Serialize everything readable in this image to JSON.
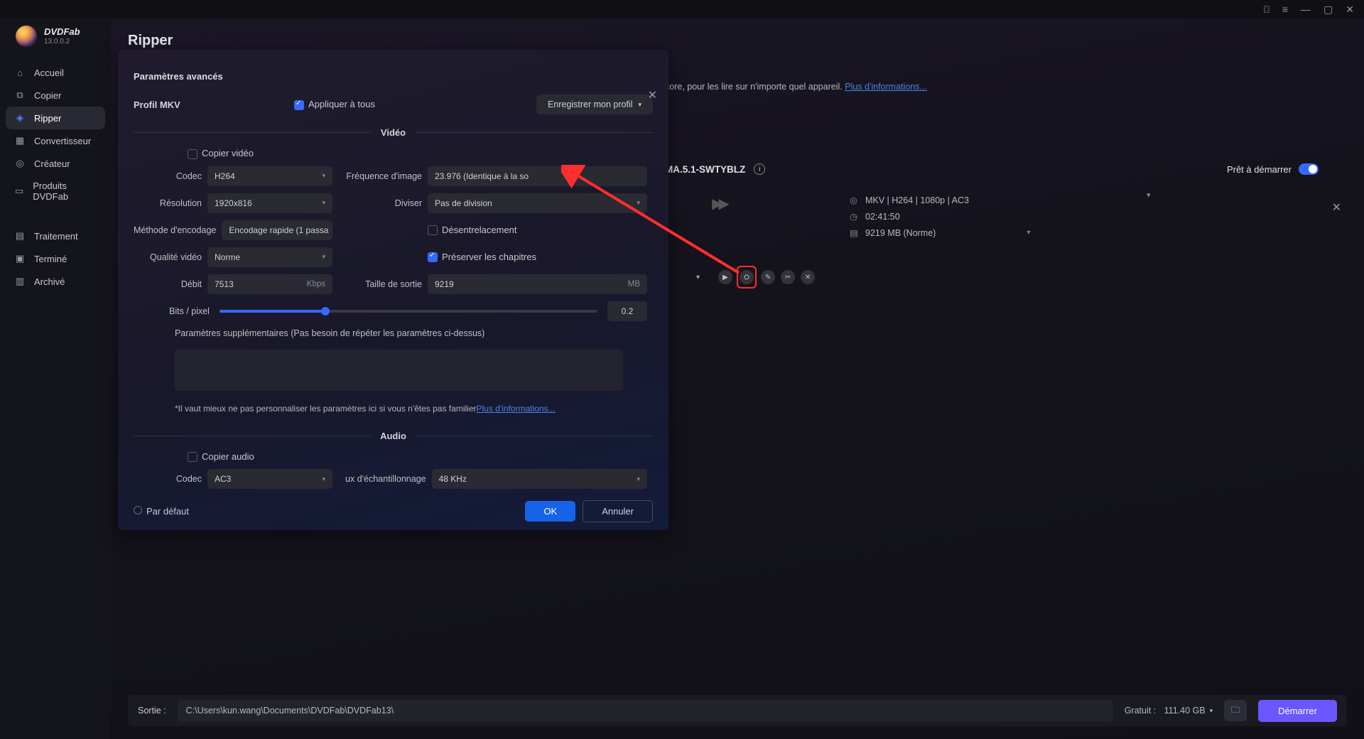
{
  "app": {
    "name": "DVDFab",
    "version": "13.0.0.2"
  },
  "sidebar": {
    "items": [
      {
        "label": "Accueil"
      },
      {
        "label": "Copier"
      },
      {
        "label": "Ripper"
      },
      {
        "label": "Convertisseur"
      },
      {
        "label": "Créateur"
      },
      {
        "label": "Produits DVDFab"
      }
    ],
    "sections": [
      {
        "label": "Traitement"
      },
      {
        "label": "Terminé"
      },
      {
        "label": "Archivé"
      }
    ]
  },
  "page": {
    "title": "Ripper",
    "desc_tail": "core, pour les lire sur n'importe quel appareil. ",
    "more_link": "Plus d'informations..."
  },
  "item": {
    "title_tail": "MA.5.1-SWTYBLZ",
    "ready": "Prêt à démarrer",
    "format": "MKV | H264 | 1080p | AC3",
    "duration": "02:41:50",
    "size": "9219 MB (Norme)"
  },
  "panel": {
    "subtitle": "Paramètres avancés",
    "profile_label": "Profil  MKV",
    "apply_all": "Appliquer à tous",
    "save_profile": "Enregistrer mon profil",
    "video": {
      "heading": "Vidéo",
      "copy_video": "Copier vidéo",
      "codec_l": "Codec",
      "codec_v": "H264",
      "res_l": "Résolution",
      "res_v": "1920x816",
      "enc_l": "Méthode d'encodage",
      "enc_v": "Encodage rapide (1 passa",
      "q_l": "Qualité vidéo",
      "q_v": "Norme",
      "bitrate_l": "Débit",
      "bitrate_v": "7513",
      "bitrate_u": "Kbps",
      "fps_l": "Fréquence d'image",
      "fps_v": "23.976 (Identique à la so",
      "split_l": "Diviser",
      "split_v": "Pas de division",
      "deint": "Désentrelacement",
      "chapters": "Préserver les chapitres",
      "out_l": "Taille de sortie",
      "out_v": "9219",
      "out_u": "MB",
      "bpp_l": "Bits / pixel",
      "bpp_v": "0.2",
      "extra_l": "Paramètres supplémentaires (Pas besoin de répéter les paramètres ci-dessus)",
      "note_pre": "*Il vaut mieux ne pas personnaliser les paramètres ici si vous n'êtes pas familier",
      "note_link": "Plus d'informations..."
    },
    "audio": {
      "heading": "Audio",
      "copy_audio": "Copier audio",
      "codec_l": "Codec",
      "codec_v": "AC3",
      "sr_l": "ux d'échantillonnage",
      "sr_v": "48 KHz"
    },
    "default": "Par défaut",
    "ok": "OK",
    "cancel": "Annuler"
  },
  "footer": {
    "out_l": "Sortie :",
    "out_path": "C:\\Users\\kun.wang\\Documents\\DVDFab\\DVDFab13\\",
    "free_l": "Gratuit :",
    "free_v": "111.40 GB",
    "start": "Démarrer"
  }
}
